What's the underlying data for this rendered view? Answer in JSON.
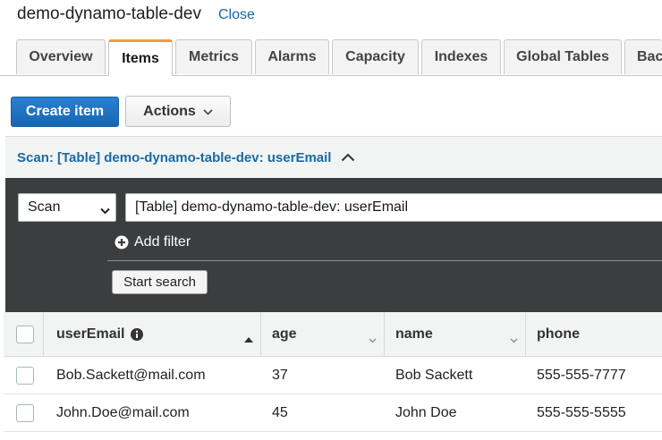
{
  "header": {
    "table_name": "demo-dynamo-table-dev",
    "close_label": "Close"
  },
  "tabs": [
    {
      "label": "Overview",
      "active": false
    },
    {
      "label": "Items",
      "active": true
    },
    {
      "label": "Metrics",
      "active": false
    },
    {
      "label": "Alarms",
      "active": false
    },
    {
      "label": "Capacity",
      "active": false
    },
    {
      "label": "Indexes",
      "active": false
    },
    {
      "label": "Global Tables",
      "active": false
    },
    {
      "label": "Bac",
      "active": false
    }
  ],
  "toolbar": {
    "create_label": "Create item",
    "actions_label": "Actions"
  },
  "scan": {
    "header_title": "Scan: [Table] demo-dynamo-table-dev: userEmail",
    "mode_value": "Scan",
    "target_value": "[Table] demo-dynamo-table-dev: userEmail",
    "add_filter_label": "Add filter",
    "start_search_label": "Start search"
  },
  "results": {
    "columns": [
      "userEmail",
      "age",
      "name",
      "phone"
    ],
    "rows": [
      {
        "userEmail": "Bob.Sackett@mail.com",
        "age": "37",
        "name": "Bob Sackett",
        "phone": "555-555-7777"
      },
      {
        "userEmail": "John.Doe@mail.com",
        "age": "45",
        "name": "John Doe",
        "phone": "555-555-5555"
      }
    ]
  },
  "colors": {
    "accent": "#1566a9",
    "primary_button": "#1866b3",
    "active_tab_border": "#f0a030",
    "scan_panel_bg": "#3c3d3e"
  },
  "icons": {
    "actions": "chevron-down-icon",
    "scan_header": "chevron-up-icon",
    "select": "chevron-down-icon",
    "add_filter": "plus-circle-icon",
    "user_email_info": "info-icon",
    "sort": "sort-ascending-icon"
  }
}
